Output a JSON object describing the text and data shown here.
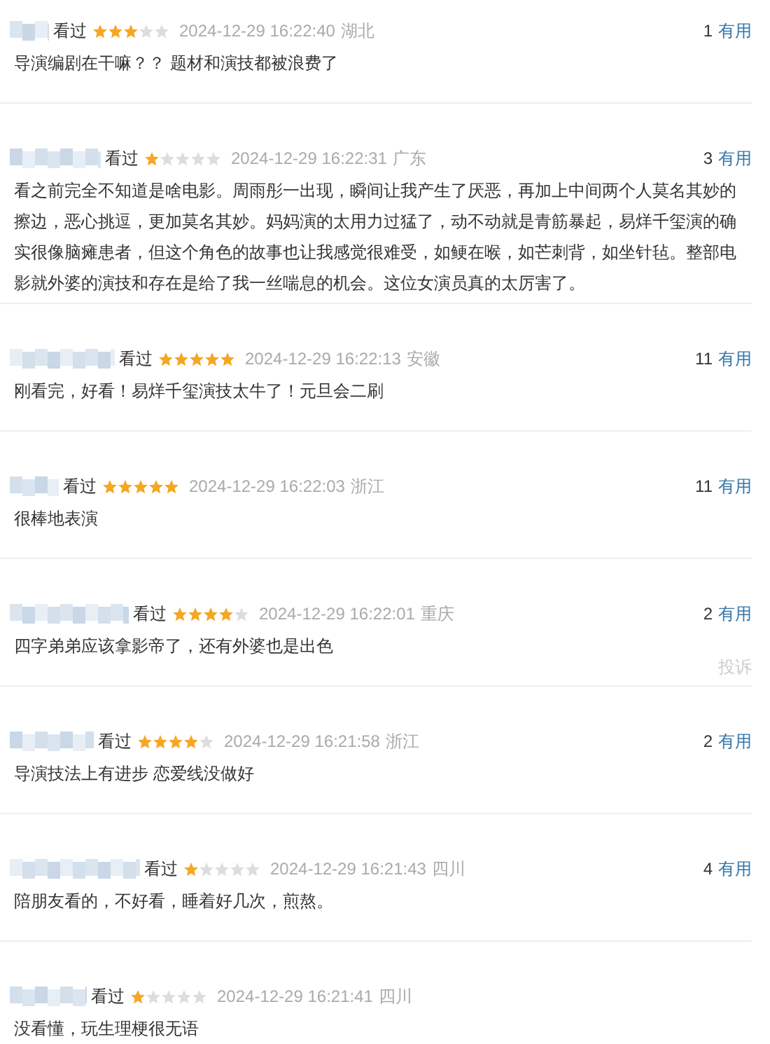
{
  "reviews": [
    {
      "status": "看过",
      "stars": 3,
      "time": "2024-12-29 16:22:40",
      "location": "湖北",
      "useful_count": "1",
      "useful_label": "有用",
      "comment": "导演编剧在干嘛？？ 题材和演技都被浪费了"
    },
    {
      "status": "看过",
      "stars": 1,
      "time": "2024-12-29 16:22:31",
      "location": "广东",
      "useful_count": "3",
      "useful_label": "有用",
      "comment": "看之前完全不知道是啥电影。周雨彤一出现，瞬间让我产生了厌恶，再加上中间两个人莫名其妙的擦边，恶心挑逗，更加莫名其妙。妈妈演的太用力过猛了，动不动就是青筋暴起，易烊千玺演的确实很像脑瘫患者，但这个角色的故事也让我感觉很难受，如鲠在喉，如芒刺背，如坐针毡。整部电影就外婆的演技和存在是给了我一丝喘息的机会。这位女演员真的太厉害了。"
    },
    {
      "status": "看过",
      "stars": 5,
      "time": "2024-12-29 16:22:13",
      "location": "安徽",
      "useful_count": "11",
      "useful_label": "有用",
      "comment": "刚看完，好看！易烊千玺演技太牛了！元旦会二刷"
    },
    {
      "status": "看过",
      "stars": 5,
      "time": "2024-12-29 16:22:03",
      "location": "浙江",
      "useful_count": "11",
      "useful_label": "有用",
      "comment": "很棒地表演"
    },
    {
      "status": "看过",
      "stars": 4,
      "time": "2024-12-29 16:22:01",
      "location": "重庆",
      "useful_count": "2",
      "useful_label": "有用",
      "comment": "四字弟弟应该拿影帝了，还有外婆也是出色",
      "report": "投诉"
    },
    {
      "status": "看过",
      "stars": 4,
      "time": "2024-12-29 16:21:58",
      "location": "浙江",
      "useful_count": "2",
      "useful_label": "有用",
      "comment": "导演技法上有进步 恋爱线没做好"
    },
    {
      "status": "看过",
      "stars": 1,
      "time": "2024-12-29 16:21:43",
      "location": "四川",
      "useful_count": "4",
      "useful_label": "有用",
      "comment": "陪朋友看的，不好看，睡着好几次，煎熬。"
    },
    {
      "status": "看过",
      "stars": 1,
      "time": "2024-12-29 16:21:41",
      "location": "四川",
      "comment": "没看懂，玩生理梗很无语"
    }
  ]
}
